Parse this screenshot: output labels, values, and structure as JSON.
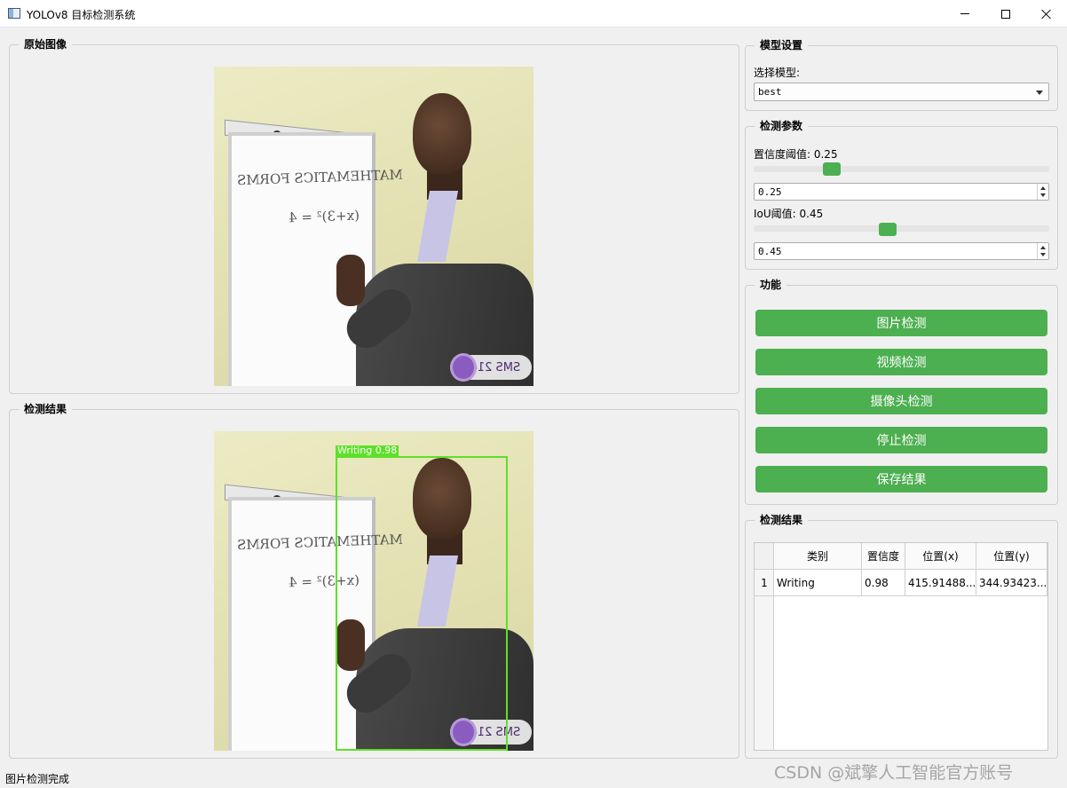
{
  "window": {
    "title": "YOLOv8 目标检测系统"
  },
  "original_panel": {
    "title": "原始图像"
  },
  "result_panel": {
    "title": "检测结果",
    "detection_label": "Writing  0.98",
    "box_color": "#5ee02a"
  },
  "scene": {
    "board_text_1": "MATHEMATICS FORMS",
    "board_text_2": "(x+3)² = 4",
    "watermark_logo": "SMS 21450"
  },
  "model_settings": {
    "title": "模型设置",
    "select_label": "选择模型:",
    "selected_model": "best"
  },
  "detect_params": {
    "title": "检测参数",
    "conf_label": "置信度阈值: 0.25",
    "conf_value": "0.25",
    "conf_level": 0.25,
    "iou_label": "IoU阈值: 0.45",
    "iou_value": "0.45",
    "iou_level": 0.45
  },
  "functions": {
    "title": "功能",
    "buttons": [
      "图片检测",
      "视频检测",
      "摄像头检测",
      "停止检测",
      "保存结果"
    ],
    "button_color": "#4caf50"
  },
  "results_table": {
    "title": "检测结果",
    "headers": [
      "类别",
      "置信度",
      "位置(x)",
      "位置(y)"
    ],
    "rows": [
      {
        "num": "1",
        "class": "Writing",
        "conf": "0.98",
        "x": "415.91488...",
        "y": "344.93423..."
      }
    ]
  },
  "status": {
    "text": "图片检测完成"
  },
  "watermark": {
    "text": "CSDN @斌擎人工智能官方账号"
  }
}
